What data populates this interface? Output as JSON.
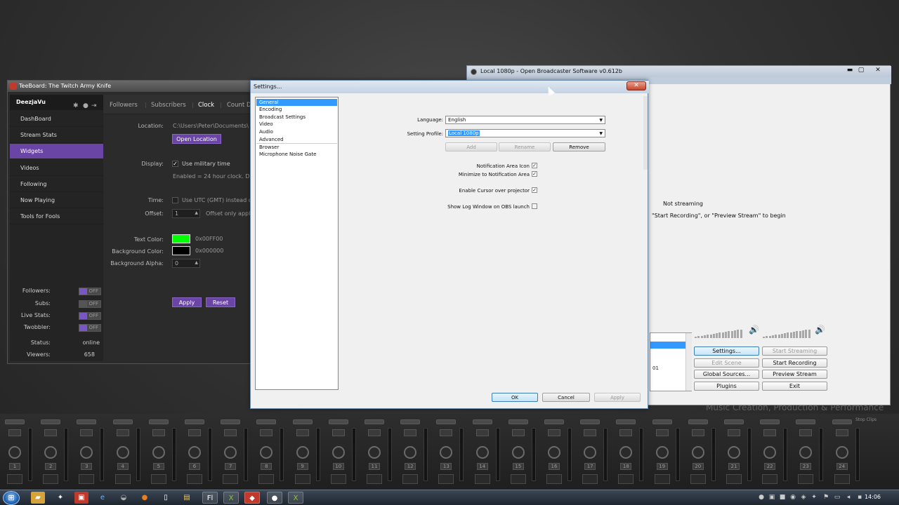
{
  "desktop": {
    "brand_text": "Music Creation, Production & Performance"
  },
  "mixer": {
    "strip_numbers": [
      "1",
      "2",
      "3",
      "4",
      "5",
      "6",
      "7",
      "8",
      "9",
      "10",
      "11",
      "12",
      "13",
      "14",
      "15",
      "16",
      "17",
      "18",
      "19",
      "20",
      "21",
      "22",
      "23",
      "24"
    ],
    "stop_clips_label": "Stop Clips"
  },
  "teeboard": {
    "title": "TeeBoard: The Twitch Army Knife",
    "username": "DeezjaVu",
    "nav": [
      "DashBoard",
      "Stream Stats",
      "Widgets",
      "Videos",
      "Following",
      "Now Playing",
      "Tools for Fools"
    ],
    "active_nav": "Widgets",
    "tabs": [
      "Followers",
      "Subscribers",
      "Clock",
      "Count D"
    ],
    "active_tab": "Clock",
    "location_label": "Location:",
    "location_value": "C:\\Users\\Peter\\Documents\\",
    "open_location": "Open Location",
    "display_label": "Display:",
    "military_label": "Use military time",
    "military_note": "Enabled = 24 hour clock. Dis",
    "time_label": "Time:",
    "utc_label": "Use UTC (GMT) instead o",
    "offset_label": "Offset:",
    "offset_value": "1",
    "offset_note": "Offset only appli",
    "text_color_label": "Text Color:",
    "text_color_value": "0x00FF00",
    "text_color": "#00ff00",
    "bg_color_label": "Background Color:",
    "bg_color_value": "0x000000",
    "bg_color": "#000000",
    "bg_alpha_label": "Background Alpha:",
    "bg_alpha_value": "0",
    "apply": "Apply",
    "reset": "Reset",
    "toggles": [
      {
        "label": "Followers:",
        "state": "OFF"
      },
      {
        "label": "Subs:",
        "state": "OFF"
      },
      {
        "label": "Live Stats:",
        "state": "OFF"
      },
      {
        "label": "Twobbler:",
        "state": "OFF"
      }
    ],
    "status_label": "Status:",
    "status_value": "online",
    "viewers_label": "Viewers:",
    "viewers_value": "658",
    "accent": "#6a45a5"
  },
  "obs": {
    "title": "Local 1080p - Open Broadcaster Software v0.612b",
    "status": "Not streaming",
    "hint": "\"Start Recording\", or \"Preview Stream\" to begin",
    "scene_item": "01",
    "buttons": [
      "Settings...",
      "Start Streaming",
      "Edit Scene",
      "Start Recording",
      "Global Sources...",
      "Preview Stream",
      "Plugins",
      "Exit"
    ]
  },
  "settings": {
    "title": "Settings...",
    "close": "✕",
    "categories": [
      "General",
      "Encoding",
      "Broadcast Settings",
      "Video",
      "Audio",
      "Advanced",
      "Browser",
      "Microphone Noise Gate"
    ],
    "selected_category": "General",
    "language_label": "Language:",
    "language_value": "English",
    "profile_label": "Setting Profile:",
    "profile_value": "Local 1080p",
    "add": "Add",
    "rename": "Rename",
    "remove": "Remove",
    "options": [
      {
        "label": "Notification Area Icon",
        "checked": true
      },
      {
        "label": "Minimize to Notification Area",
        "checked": true
      },
      {
        "label": "Enable Cursor over projector",
        "checked": true
      },
      {
        "label": "Show Log Window on OBS launch",
        "checked": false
      }
    ],
    "ok": "OK",
    "cancel": "Cancel",
    "apply": "Apply"
  },
  "taskbar": {
    "time": "14:06"
  }
}
